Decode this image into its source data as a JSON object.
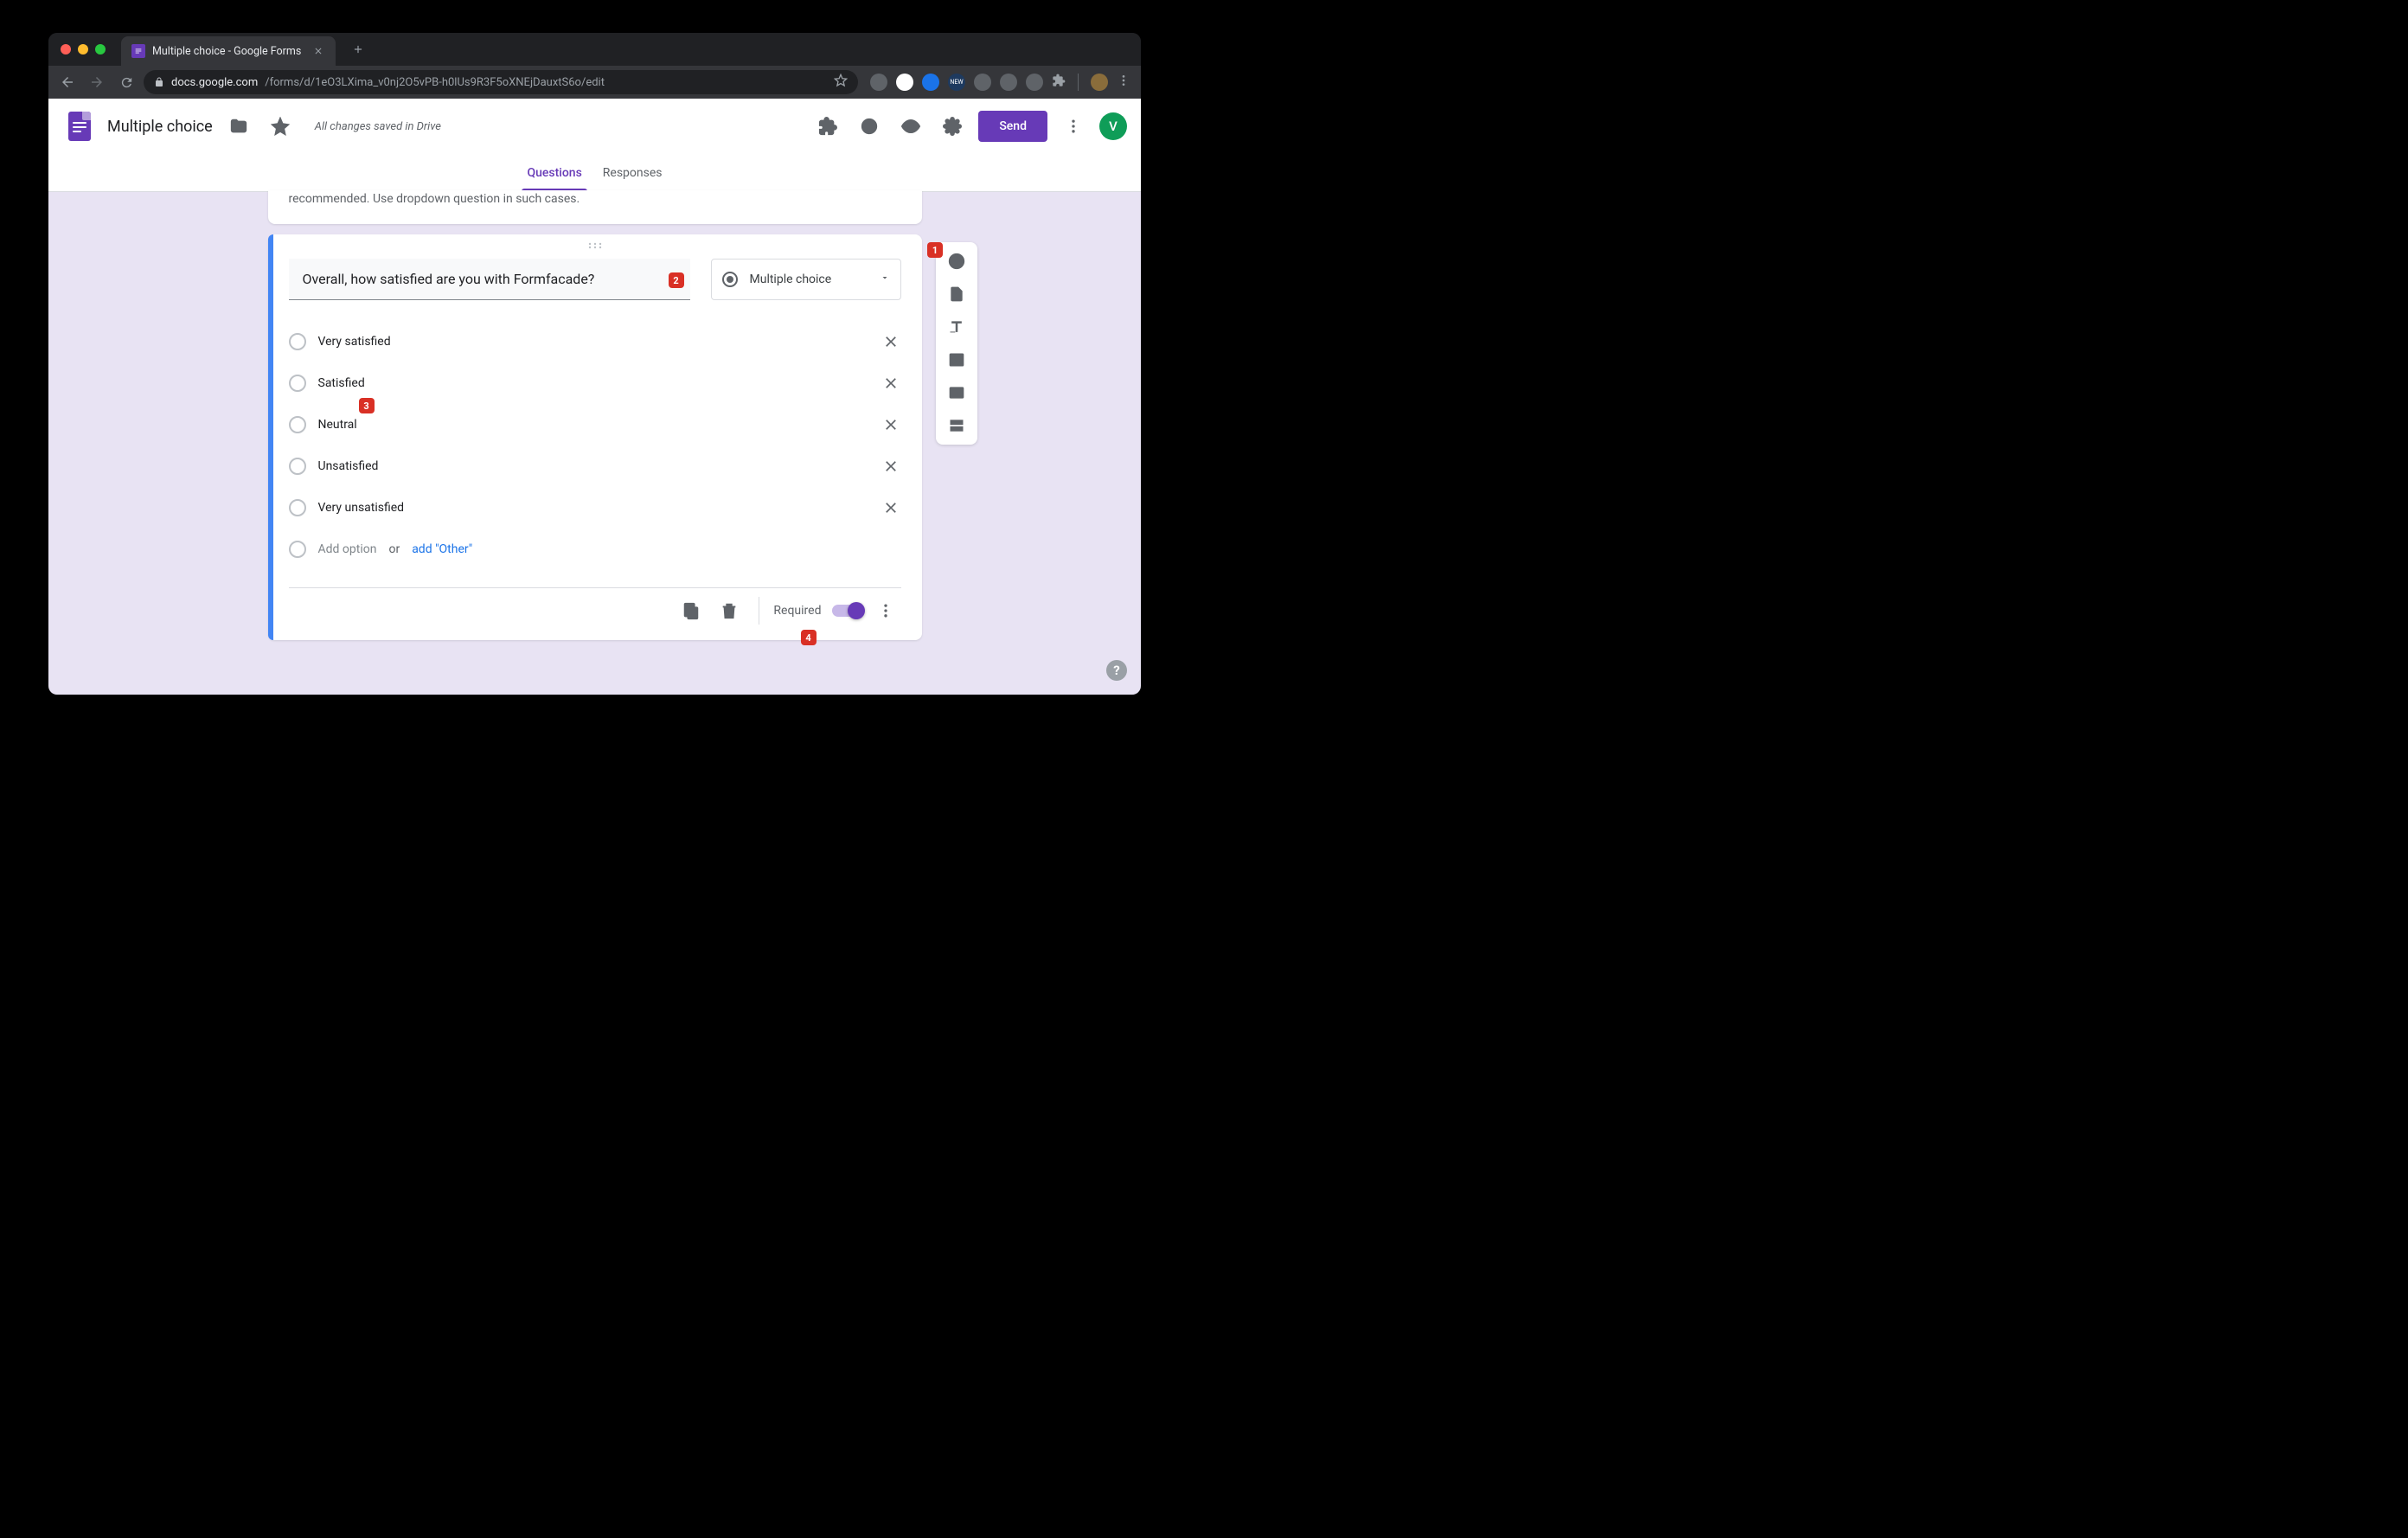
{
  "browser": {
    "tab_title": "Multiple choice - Google Forms",
    "url_domain": "docs.google.com",
    "url_path": "/forms/d/1eO3LXima_v0nj2O5vPB-h0lUs9R3F5oXNEjDauxtS6o/edit"
  },
  "header": {
    "doc_title": "Multiple choice",
    "save_status": "All changes saved in Drive",
    "send_label": "Send",
    "avatar_letter": "V"
  },
  "tabs": {
    "questions": "Questions",
    "responses": "Responses"
  },
  "description_card": {
    "text_visible": "recommended. Use dropdown question in such cases."
  },
  "question": {
    "title": "Overall, how satisfied are you with Formfacade?",
    "type_label": "Multiple choice",
    "options": [
      "Very satisfied",
      "Satisfied",
      "Neutral",
      "Unsatisfied",
      "Very unsatisfied"
    ],
    "add_option_placeholder": "Add option",
    "or_text": "or",
    "add_other_label": "add \"Other\"",
    "required_label": "Required",
    "required_on": true
  },
  "badges": {
    "b1": "1",
    "b2": "2",
    "b3": "3",
    "b4": "4"
  },
  "colors": {
    "accent": "#673ab7",
    "danger": "#d93025",
    "blue": "#4285f4"
  }
}
